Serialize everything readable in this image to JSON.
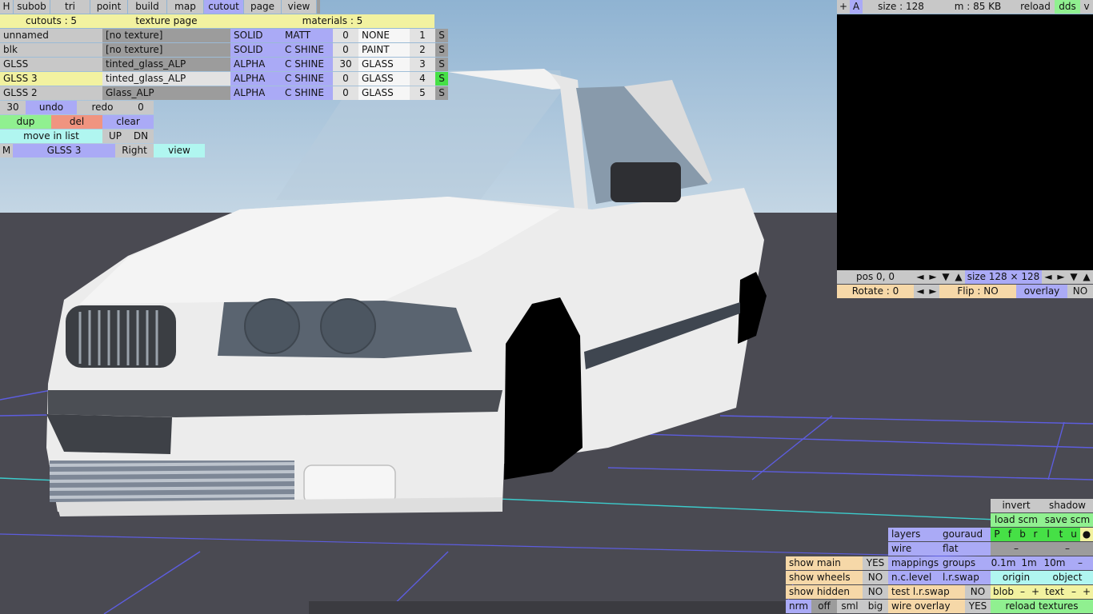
{
  "menu": [
    "H",
    "subob",
    "tri",
    "point",
    "build",
    "map",
    "cutout",
    "page",
    "view"
  ],
  "cutout_panel": {
    "cutouts_label": "cutouts : 5",
    "texture_page_label": "texture page",
    "materials_label": "materials : 5",
    "rows": [
      {
        "name": "unnamed",
        "texture": "[no texture]",
        "mode": "SOLID",
        "shine": "MATT",
        "value": "0",
        "material": "NONE",
        "index": "1",
        "s": "S"
      },
      {
        "name": "blk",
        "texture": "[no texture]",
        "mode": "SOLID",
        "shine": "C SHINE",
        "value": "0",
        "material": "PAINT",
        "index": "2",
        "s": "S"
      },
      {
        "name": "GLSS",
        "texture": "tinted_glass_ALP",
        "mode": "ALPHA",
        "shine": "C SHINE",
        "value": "30",
        "material": "GLASS",
        "index": "3",
        "s": "S"
      },
      {
        "name": "GLSS 3",
        "texture": "tinted_glass_ALP",
        "mode": "ALPHA",
        "shine": "C SHINE",
        "value": "0",
        "material": "GLASS",
        "index": "4",
        "s": "S"
      },
      {
        "name": "GLSS 2",
        "texture": "Glass_ALP",
        "mode": "ALPHA",
        "shine": "C SHINE",
        "value": "0",
        "material": "GLASS",
        "index": "5",
        "s": "S"
      }
    ],
    "history_count": "30",
    "undo": "undo",
    "redo": "redo",
    "redo_count": "0",
    "dup": "dup",
    "del": "del",
    "clear": "clear",
    "move_in_list": "move in list",
    "up": "UP",
    "dn": "DN",
    "m": "M",
    "selected": "GLSS 3",
    "side": "Right",
    "view": "view"
  },
  "texture_panel": {
    "plus": "+",
    "a": "A",
    "size": "size : 128",
    "memory": "m : 85 KB",
    "reload": "reload",
    "dds": "dds",
    "v": "v",
    "pos": "pos 0, 0",
    "size_dims": "size 128 × 128",
    "rotate": "Rotate : 0",
    "flip": "Flip : NO",
    "overlay": "overlay",
    "overlay_value": "NO",
    "arrows": {
      "left": "◄",
      "right": "►",
      "down": "▼",
      "up": "▲"
    }
  },
  "view_panel": {
    "invert": "invert",
    "shadow": "shadow",
    "load_scm": "load scm",
    "save_scm": "save scm",
    "layers": "layers",
    "gouraud": "gouraud",
    "layer_toggles": [
      "P",
      "f",
      "b",
      "r",
      "l",
      "t",
      "u",
      "●"
    ],
    "wire": "wire",
    "flat": "flat",
    "dash": "–",
    "show_main": "show main",
    "show_main_value": "YES",
    "mappings": "mappings",
    "groups": "groups",
    "grid_sizes": [
      "0.1m",
      "1m",
      "10m",
      "–"
    ],
    "show_wheels": "show wheels",
    "show_wheels_value": "NO",
    "nc_level": "n.c.level",
    "lr_swap": "l.r.swap",
    "origin": "origin",
    "object": "object",
    "show_hidden": "show hidden",
    "show_hidden_value": "NO",
    "test_lr_swap": "test l.r.swap",
    "test_lr_swap_value": "NO",
    "blob": "blob",
    "minus": "–",
    "plus": "+",
    "text": "text",
    "nrm": "nrm",
    "off": "off",
    "sml": "sml",
    "big": "big",
    "wire_overlay": "wire overlay",
    "wire_overlay_value": "YES",
    "reload_textures": "reload textures"
  },
  "colors": {
    "sky": "#a9c4dd",
    "ground": "#4a4a52",
    "grid_line": "#6060e8",
    "axis_line": "#40d0d0",
    "button_gray": "#c8c8c8",
    "button_blue": "#aaaaf6",
    "button_yellow": "#f2f2a0",
    "button_orange": "#f6d8a8",
    "button_cyan": "#b0f6f0",
    "button_green": "#90f090",
    "button_red": "#f09480",
    "active_tab": "#aaaaf6"
  }
}
